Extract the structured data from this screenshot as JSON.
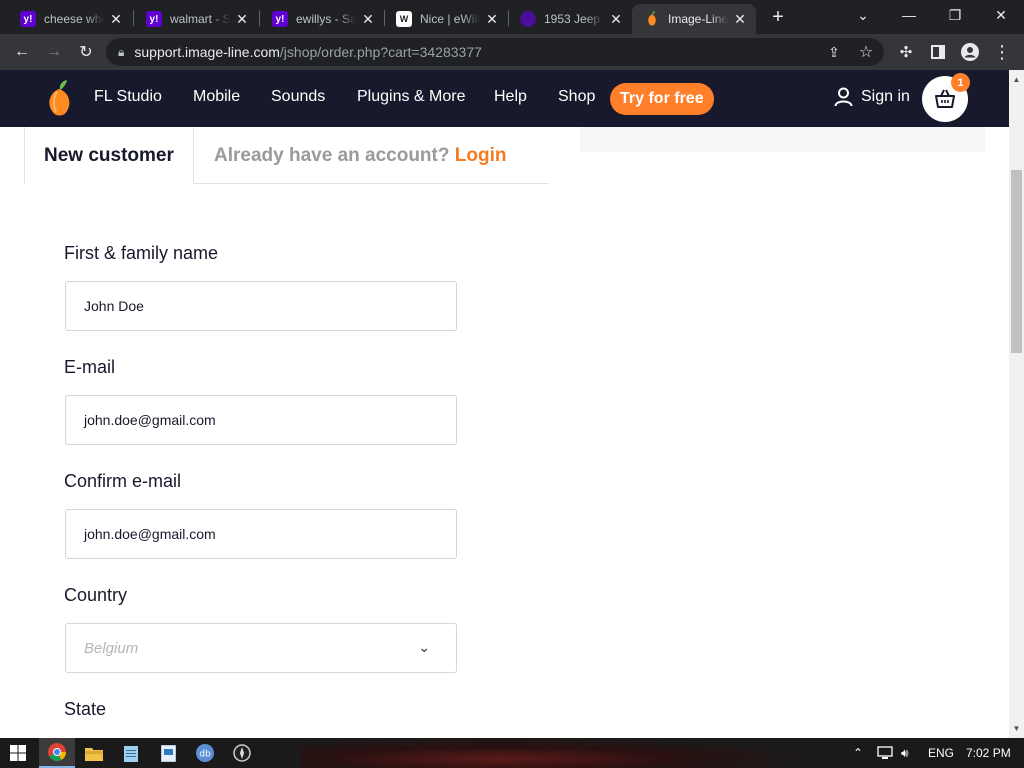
{
  "browser": {
    "tabs": [
      {
        "title": "cheese whe",
        "favicon": "yahoo-icon",
        "color": "#5f01d1"
      },
      {
        "title": "walmart - S",
        "favicon": "yahoo-icon",
        "color": "#5f01d1"
      },
      {
        "title": "ewillys - Sa",
        "favicon": "yahoo-icon",
        "color": "#5f01d1"
      },
      {
        "title": "Nice | eWill",
        "favicon": "ewillys-icon",
        "color": "#ffffff"
      },
      {
        "title": "1953 Jeep",
        "favicon": "jeep-icon",
        "color": "#4b0f9c"
      },
      {
        "title": "Image-Line",
        "favicon": "fl-studio-icon",
        "color": "#ff7f2a"
      }
    ],
    "url_host": "support.image-line.com",
    "url_path": "/jshop/order.php?cart=34283377"
  },
  "site": {
    "nav": [
      "FL Studio",
      "Mobile",
      "Sounds",
      "Plugins & More",
      "Help",
      "Shop"
    ],
    "try_free": "Try for free",
    "sign_in": "Sign in",
    "cart_count": "1",
    "accent": "#ff7f2a",
    "header_bg": "#18192c"
  },
  "form": {
    "tab_new": "New customer",
    "tab_existing": "Already have an account?",
    "tab_login": "Login",
    "name_label": "First & family name",
    "name_value": "John Doe",
    "email_label": "E-mail",
    "email_value": "john.doe@gmail.com",
    "confirm_label": "Confirm e-mail",
    "confirm_value": "john.doe@gmail.com",
    "country_label": "Country",
    "country_placeholder": "Belgium",
    "state_label": "State"
  },
  "taskbar": {
    "lang": "ENG",
    "time": "7:02 PM"
  }
}
